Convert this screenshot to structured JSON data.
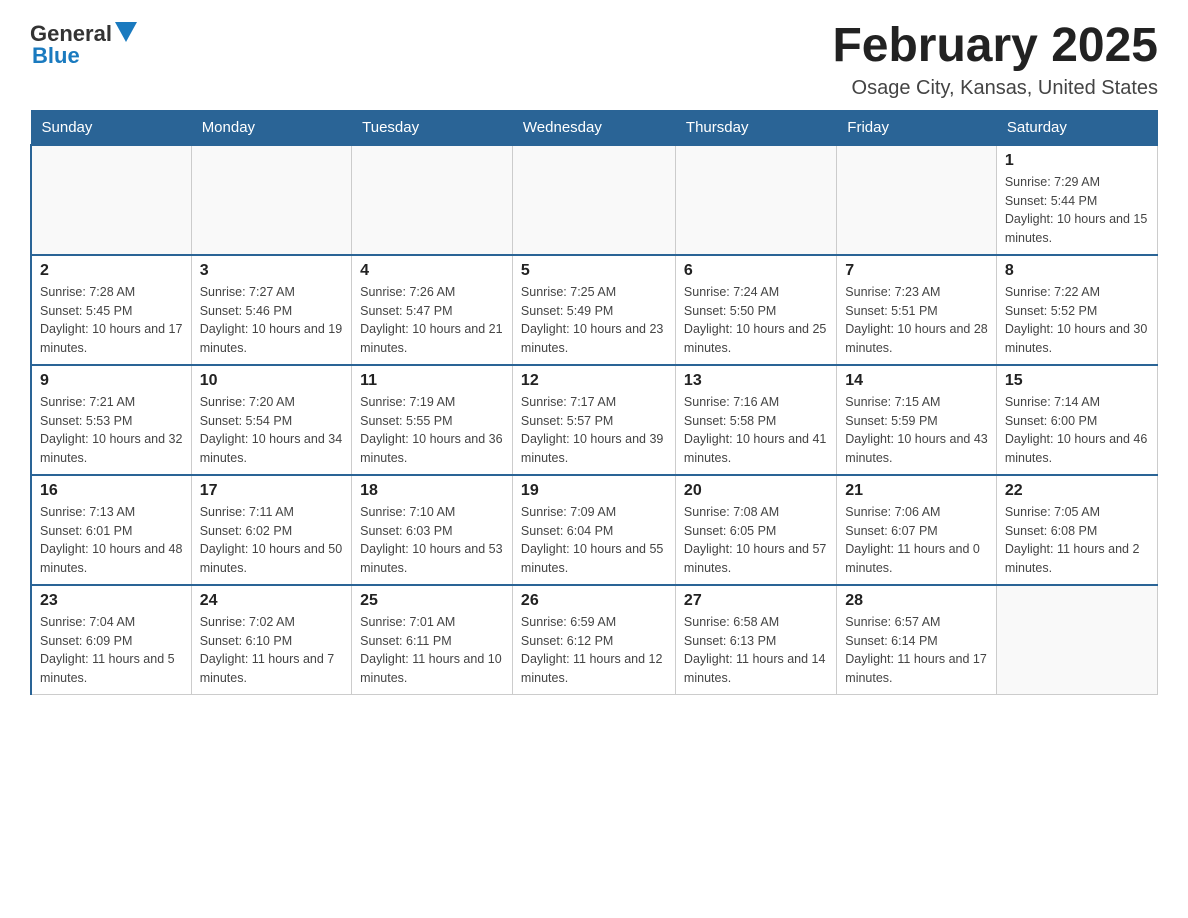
{
  "logo": {
    "text_general": "General",
    "text_blue": "Blue"
  },
  "title": "February 2025",
  "location": "Osage City, Kansas, United States",
  "days_of_week": [
    "Sunday",
    "Monday",
    "Tuesday",
    "Wednesday",
    "Thursday",
    "Friday",
    "Saturday"
  ],
  "weeks": [
    [
      {
        "day": "",
        "info": ""
      },
      {
        "day": "",
        "info": ""
      },
      {
        "day": "",
        "info": ""
      },
      {
        "day": "",
        "info": ""
      },
      {
        "day": "",
        "info": ""
      },
      {
        "day": "",
        "info": ""
      },
      {
        "day": "1",
        "info": "Sunrise: 7:29 AM\nSunset: 5:44 PM\nDaylight: 10 hours and 15 minutes."
      }
    ],
    [
      {
        "day": "2",
        "info": "Sunrise: 7:28 AM\nSunset: 5:45 PM\nDaylight: 10 hours and 17 minutes."
      },
      {
        "day": "3",
        "info": "Sunrise: 7:27 AM\nSunset: 5:46 PM\nDaylight: 10 hours and 19 minutes."
      },
      {
        "day": "4",
        "info": "Sunrise: 7:26 AM\nSunset: 5:47 PM\nDaylight: 10 hours and 21 minutes."
      },
      {
        "day": "5",
        "info": "Sunrise: 7:25 AM\nSunset: 5:49 PM\nDaylight: 10 hours and 23 minutes."
      },
      {
        "day": "6",
        "info": "Sunrise: 7:24 AM\nSunset: 5:50 PM\nDaylight: 10 hours and 25 minutes."
      },
      {
        "day": "7",
        "info": "Sunrise: 7:23 AM\nSunset: 5:51 PM\nDaylight: 10 hours and 28 minutes."
      },
      {
        "day": "8",
        "info": "Sunrise: 7:22 AM\nSunset: 5:52 PM\nDaylight: 10 hours and 30 minutes."
      }
    ],
    [
      {
        "day": "9",
        "info": "Sunrise: 7:21 AM\nSunset: 5:53 PM\nDaylight: 10 hours and 32 minutes."
      },
      {
        "day": "10",
        "info": "Sunrise: 7:20 AM\nSunset: 5:54 PM\nDaylight: 10 hours and 34 minutes."
      },
      {
        "day": "11",
        "info": "Sunrise: 7:19 AM\nSunset: 5:55 PM\nDaylight: 10 hours and 36 minutes."
      },
      {
        "day": "12",
        "info": "Sunrise: 7:17 AM\nSunset: 5:57 PM\nDaylight: 10 hours and 39 minutes."
      },
      {
        "day": "13",
        "info": "Sunrise: 7:16 AM\nSunset: 5:58 PM\nDaylight: 10 hours and 41 minutes."
      },
      {
        "day": "14",
        "info": "Sunrise: 7:15 AM\nSunset: 5:59 PM\nDaylight: 10 hours and 43 minutes."
      },
      {
        "day": "15",
        "info": "Sunrise: 7:14 AM\nSunset: 6:00 PM\nDaylight: 10 hours and 46 minutes."
      }
    ],
    [
      {
        "day": "16",
        "info": "Sunrise: 7:13 AM\nSunset: 6:01 PM\nDaylight: 10 hours and 48 minutes."
      },
      {
        "day": "17",
        "info": "Sunrise: 7:11 AM\nSunset: 6:02 PM\nDaylight: 10 hours and 50 minutes."
      },
      {
        "day": "18",
        "info": "Sunrise: 7:10 AM\nSunset: 6:03 PM\nDaylight: 10 hours and 53 minutes."
      },
      {
        "day": "19",
        "info": "Sunrise: 7:09 AM\nSunset: 6:04 PM\nDaylight: 10 hours and 55 minutes."
      },
      {
        "day": "20",
        "info": "Sunrise: 7:08 AM\nSunset: 6:05 PM\nDaylight: 10 hours and 57 minutes."
      },
      {
        "day": "21",
        "info": "Sunrise: 7:06 AM\nSunset: 6:07 PM\nDaylight: 11 hours and 0 minutes."
      },
      {
        "day": "22",
        "info": "Sunrise: 7:05 AM\nSunset: 6:08 PM\nDaylight: 11 hours and 2 minutes."
      }
    ],
    [
      {
        "day": "23",
        "info": "Sunrise: 7:04 AM\nSunset: 6:09 PM\nDaylight: 11 hours and 5 minutes."
      },
      {
        "day": "24",
        "info": "Sunrise: 7:02 AM\nSunset: 6:10 PM\nDaylight: 11 hours and 7 minutes."
      },
      {
        "day": "25",
        "info": "Sunrise: 7:01 AM\nSunset: 6:11 PM\nDaylight: 11 hours and 10 minutes."
      },
      {
        "day": "26",
        "info": "Sunrise: 6:59 AM\nSunset: 6:12 PM\nDaylight: 11 hours and 12 minutes."
      },
      {
        "day": "27",
        "info": "Sunrise: 6:58 AM\nSunset: 6:13 PM\nDaylight: 11 hours and 14 minutes."
      },
      {
        "day": "28",
        "info": "Sunrise: 6:57 AM\nSunset: 6:14 PM\nDaylight: 11 hours and 17 minutes."
      },
      {
        "day": "",
        "info": ""
      }
    ]
  ]
}
